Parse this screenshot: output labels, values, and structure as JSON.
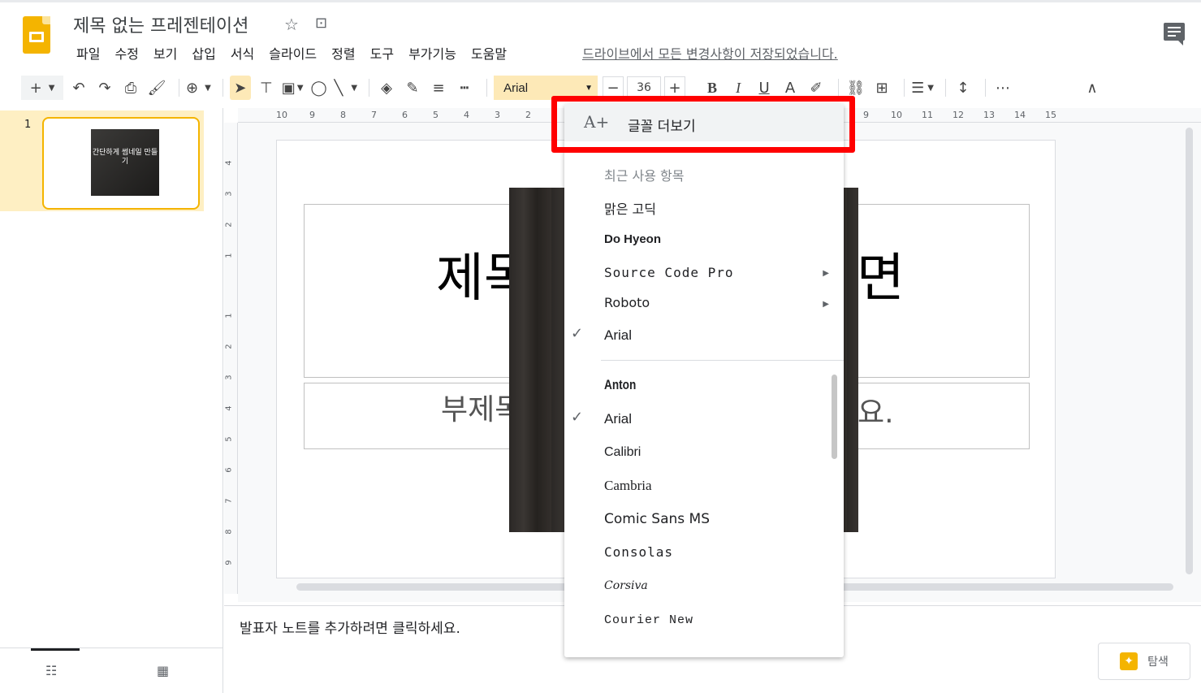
{
  "header": {
    "doc_title": "제목 없는 프레젠테이션",
    "menu": [
      "파일",
      "수정",
      "보기",
      "삽입",
      "서식",
      "슬라이드",
      "정렬",
      "도구",
      "부가기능",
      "도움말"
    ],
    "save_status": "드라이브에서 모든 변경사항이 저장되었습니다."
  },
  "toolbar": {
    "font_name": "Arial",
    "font_size": "36"
  },
  "slides_panel": {
    "slide_number": "1",
    "thumb_text": "간단하게 썸네일 만들기"
  },
  "rulers": {
    "h_ticks": [
      "10",
      "9",
      "8",
      "7",
      "6",
      "5",
      "4",
      "3",
      "2",
      "9",
      "10",
      "11",
      "12",
      "13",
      "14",
      "15"
    ],
    "v_ticks": [
      "4",
      "3",
      "2",
      "1",
      "1",
      "2",
      "3",
      "4",
      "5",
      "6",
      "7",
      "8",
      "9"
    ]
  },
  "slide": {
    "title_left": "제목",
    "title_right": "면",
    "subtitle_left": "부제목",
    "subtitle_right": "요."
  },
  "notes": {
    "placeholder": "발표자 노트를 추가하려면 클릭하세요."
  },
  "explore": {
    "label": "탐색"
  },
  "font_menu": {
    "more_fonts": "글꼴 더보기",
    "recent_header": "최근 사용 항목",
    "recent": [
      "맑은 고딕",
      "Do Hyeon",
      "Source Code Pro",
      "Roboto",
      "Arial"
    ],
    "fonts": [
      "Anton",
      "Arial",
      "Calibri",
      "Cambria",
      "Comic Sans MS",
      "Consolas",
      "Corsiva",
      "Courier New"
    ],
    "selected": "Arial"
  },
  "colors": {
    "accent_yellow": "#f4b400",
    "selection_bg": "#fde9b7",
    "highlight_red": "#ff0000"
  }
}
